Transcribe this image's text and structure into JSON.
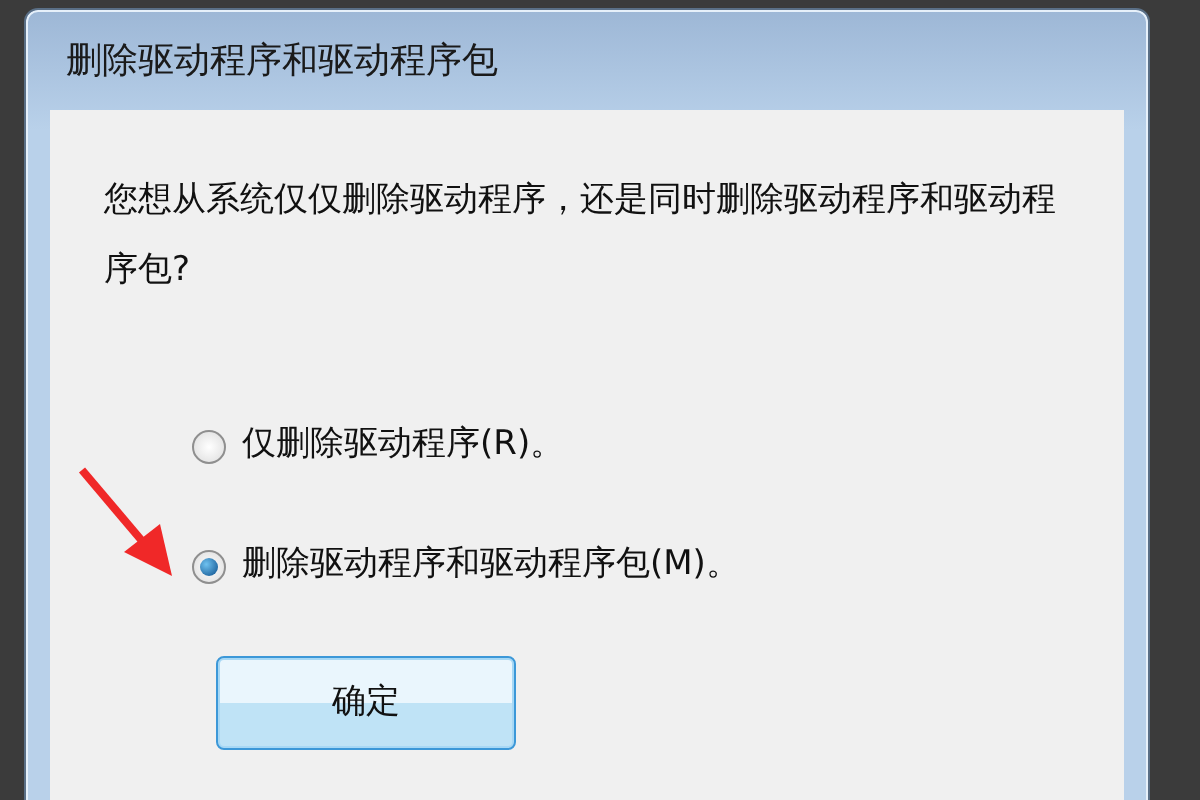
{
  "window": {
    "title": "删除驱动程序和驱动程序包"
  },
  "message": "您想从系统仅仅删除驱动程序，还是同时删除驱动程序和驱动程序包?",
  "options": [
    {
      "label": "仅删除驱动程序(R)。",
      "selected": false
    },
    {
      "label": "删除驱动程序和驱动程序包(M)。",
      "selected": true
    }
  ],
  "buttons": [
    {
      "label": "确定",
      "focused": true
    }
  ]
}
